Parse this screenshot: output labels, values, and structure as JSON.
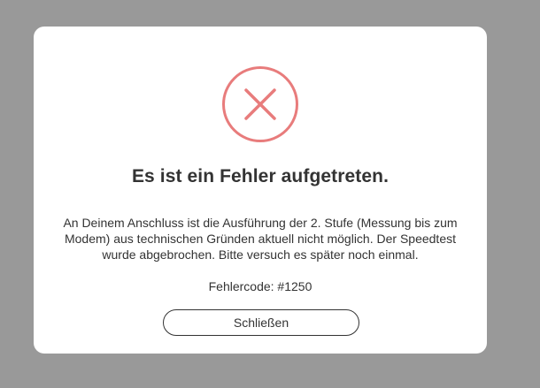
{
  "dialog": {
    "icon": "error-x-circle-icon",
    "icon_color": "#e87c7c",
    "title": "Es ist ein Fehler aufgetreten.",
    "message": "An Deinem Anschluss ist die Ausführung der 2. Stufe (Messung bis zum Modem) aus technischen Gründen aktuell nicht möglich. Der Speedtest wurde abgebrochen. Bitte versuch es später noch einmal.",
    "error_code": "Fehlercode: #1250",
    "close_label": "Schließen"
  },
  "colors": {
    "backdrop": "#999999",
    "modal_background": "#ffffff",
    "text": "#333333"
  }
}
